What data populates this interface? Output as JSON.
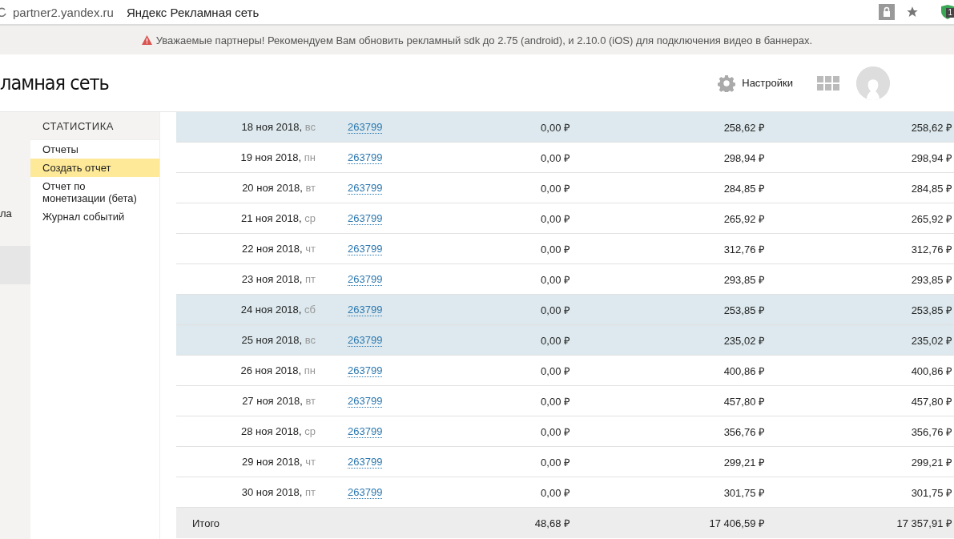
{
  "browser": {
    "url": "partner2.yandex.ru",
    "title": "Яндекс Рекламная сеть",
    "extension_badge": "1"
  },
  "banner": {
    "text": "Уважаемые партнеры! Рекомендуем Вам обновить рекламный sdk до 2.75 (android), и 2.10.0 (iOS) для подключения видео в баннерах."
  },
  "header": {
    "logo_text": "ламная сеть",
    "settings_label": "Настройки"
  },
  "left_strip": {
    "text": "ла"
  },
  "sidebar": {
    "title": "СТАТИСТИКА",
    "items": [
      {
        "label": "Отчеты",
        "selected": false
      },
      {
        "label": "Создать отчет",
        "selected": true
      },
      {
        "label": "Отчет по монетизации (бета)",
        "selected": false
      },
      {
        "label": "Журнал событий",
        "selected": false
      }
    ]
  },
  "table": {
    "rows": [
      {
        "date": "18 ноя 2018,",
        "weekday": "вс",
        "link": "263799",
        "column_3": "0,00 ₽",
        "column_4": "258,62 ₽",
        "column_5": "258,62 ₽",
        "highlighted": true
      },
      {
        "date": "19 ноя 2018,",
        "weekday": "пн",
        "link": "263799",
        "column_3": "0,00 ₽",
        "column_4": "298,94 ₽",
        "column_5": "298,94 ₽",
        "highlighted": false
      },
      {
        "date": "20 ноя 2018,",
        "weekday": "вт",
        "link": "263799",
        "column_3": "0,00 ₽",
        "column_4": "284,85 ₽",
        "column_5": "284,85 ₽",
        "highlighted": false
      },
      {
        "date": "21 ноя 2018,",
        "weekday": "ср",
        "link": "263799",
        "column_3": "0,00 ₽",
        "column_4": "265,92 ₽",
        "column_5": "265,92 ₽",
        "highlighted": false
      },
      {
        "date": "22 ноя 2018,",
        "weekday": "чт",
        "link": "263799",
        "column_3": "0,00 ₽",
        "column_4": "312,76 ₽",
        "column_5": "312,76 ₽",
        "highlighted": false
      },
      {
        "date": "23 ноя 2018,",
        "weekday": "пт",
        "link": "263799",
        "column_3": "0,00 ₽",
        "column_4": "293,85 ₽",
        "column_5": "293,85 ₽",
        "highlighted": false
      },
      {
        "date": "24 ноя 2018,",
        "weekday": "сб",
        "link": "263799",
        "column_3": "0,00 ₽",
        "column_4": "253,85 ₽",
        "column_5": "253,85 ₽",
        "highlighted": true
      },
      {
        "date": "25 ноя 2018,",
        "weekday": "вс",
        "link": "263799",
        "column_3": "0,00 ₽",
        "column_4": "235,02 ₽",
        "column_5": "235,02 ₽",
        "highlighted": true
      },
      {
        "date": "26 ноя 2018,",
        "weekday": "пн",
        "link": "263799",
        "column_3": "0,00 ₽",
        "column_4": "400,86 ₽",
        "column_5": "400,86 ₽",
        "highlighted": false
      },
      {
        "date": "27 ноя 2018,",
        "weekday": "вт",
        "link": "263799",
        "column_3": "0,00 ₽",
        "column_4": "457,80 ₽",
        "column_5": "457,80 ₽",
        "highlighted": false
      },
      {
        "date": "28 ноя 2018,",
        "weekday": "ср",
        "link": "263799",
        "column_3": "0,00 ₽",
        "column_4": "356,76 ₽",
        "column_5": "356,76 ₽",
        "highlighted": false
      },
      {
        "date": "29 ноя 2018,",
        "weekday": "чт",
        "link": "263799",
        "column_3": "0,00 ₽",
        "column_4": "299,21 ₽",
        "column_5": "299,21 ₽",
        "highlighted": false
      },
      {
        "date": "30 ноя 2018,",
        "weekday": "пт",
        "link": "263799",
        "column_3": "0,00 ₽",
        "column_4": "301,75 ₽",
        "column_5": "301,75 ₽",
        "highlighted": false
      }
    ],
    "total": {
      "label": "Итого",
      "column_3": "48,68 ₽",
      "column_4": "17 406,59 ₽",
      "column_5": "17 357,91 ₽"
    }
  }
}
